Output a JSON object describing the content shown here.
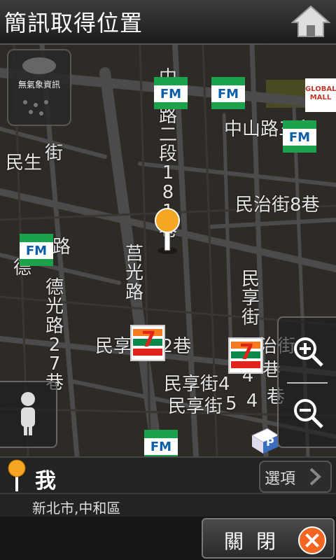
{
  "header": {
    "title": "簡訊取得位置",
    "home_icon": "home-icon"
  },
  "weather": {
    "label": "無氣象資訊",
    "icon": "cloud-rain-icon"
  },
  "map": {
    "labels_horizontal": [
      "中山路三段",
      "民生",
      "街",
      "民治街8巷",
      "民享街32巷",
      "民享街4",
      "5",
      "民享街",
      "民治街"
    ],
    "labels_vertical": [
      "中山路二段181巷",
      "莒光路",
      "德光路27巷",
      "民享街",
      "路",
      "德",
      "巷",
      "4",
      "巷",
      "4"
    ],
    "poi": {
      "fm": "FM",
      "global_mall": "GLOBAL MALL",
      "parking": "P"
    }
  },
  "me": {
    "name": "我",
    "address": "新北市,中和區"
  },
  "options_label": "選項",
  "close_label": "關閉",
  "colors": {
    "accent": "#f26522",
    "map_bg": "#2e2a26",
    "road": "#4a4a4a"
  }
}
